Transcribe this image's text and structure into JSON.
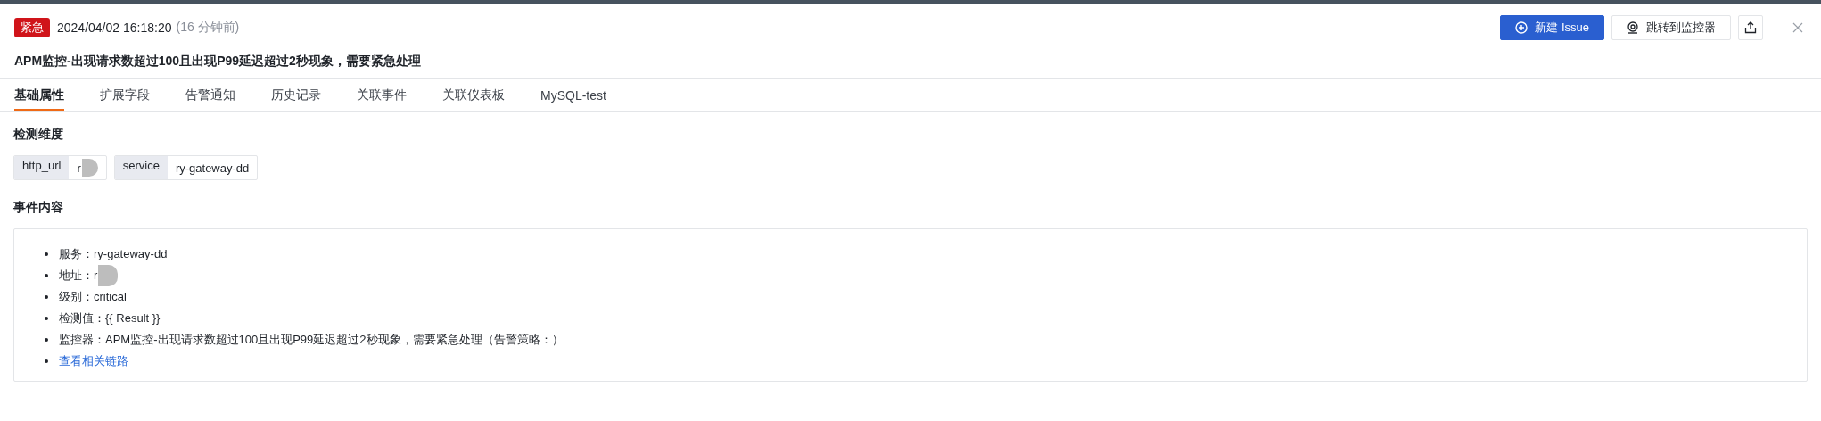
{
  "header": {
    "severity": "紧急",
    "timestamp": "2024/04/02 16:18:20",
    "relative_time": "(16 分钟前)",
    "title": "APM监控-出现请求数超过100且出现P99延迟超过2秒现象，需要紧急处理"
  },
  "actions": [
    {
      "kind": "primary",
      "label": "新建 Issue"
    },
    {
      "kind": "default",
      "label": "跳转到监控器"
    },
    {
      "kind": "export"
    },
    {
      "kind": "close"
    }
  ],
  "tabs": [
    {
      "label": "基础属性",
      "selected": true
    },
    {
      "label": "扩展字段",
      "selected": false
    },
    {
      "label": "告警通知",
      "selected": false
    },
    {
      "label": "历史记录",
      "selected": false
    },
    {
      "label": "关联事件",
      "selected": false
    },
    {
      "label": "关联仪表板",
      "selected": false
    },
    {
      "label": "MySQL-test",
      "selected": false
    }
  ],
  "dimensions": {
    "title": "检测维度",
    "tags": [
      {
        "key": "http_url",
        "value": "r",
        "redacted": true
      },
      {
        "key": "service",
        "value": "ry-gateway-dd",
        "redacted": false
      }
    ]
  },
  "content": {
    "title": "事件内容",
    "items": [
      {
        "kind": "text",
        "label": "服务：",
        "value": "ry-gateway-dd",
        "redacted": false
      },
      {
        "kind": "text",
        "label": "地址：",
        "value": "r",
        "redacted": true
      },
      {
        "kind": "text",
        "label": "级别：",
        "value": "critical",
        "redacted": false
      },
      {
        "kind": "text",
        "label": "检测值：",
        "value": "{{ Result }}",
        "redacted": false
      },
      {
        "kind": "text",
        "label": "监控器：",
        "value": "APM监控-出现请求数超过100且出现P99延迟超过2秒现象，需要紧急处理（告警策略：）",
        "redacted": false
      },
      {
        "kind": "link",
        "value": "查看相关链路"
      }
    ]
  }
}
